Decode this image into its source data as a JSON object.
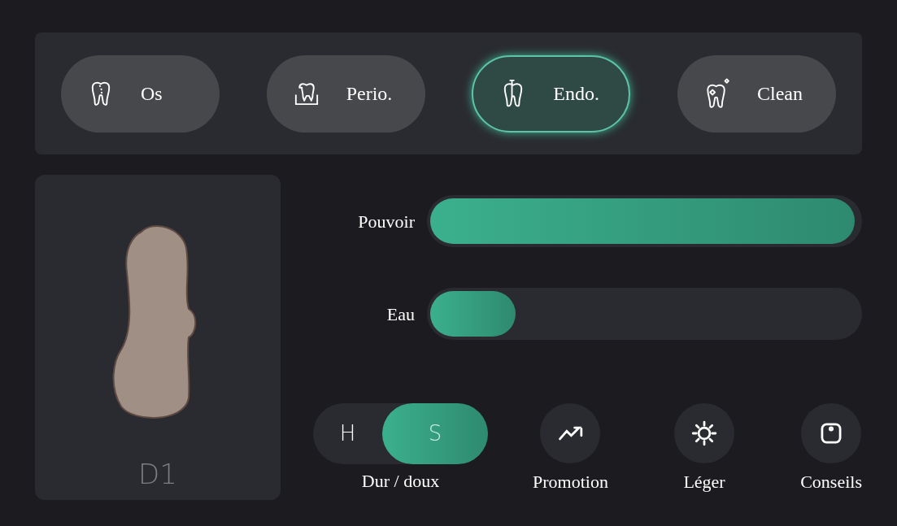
{
  "modes": [
    {
      "label": "Os",
      "kind": "bone",
      "selected": false
    },
    {
      "label": "Perio.",
      "kind": "gum",
      "selected": false
    },
    {
      "label": "Endo.",
      "kind": "root",
      "selected": true
    },
    {
      "label": "Clean",
      "kind": "sparkle",
      "selected": false
    }
  ],
  "bone_type": {
    "label": "D1"
  },
  "sliders": [
    {
      "label": "Pouvoir",
      "level": 0.99
    },
    {
      "label": "Eau",
      "level": 0.2
    }
  ],
  "hardness": {
    "caption": "Dur / doux",
    "options": [
      {
        "label": "H",
        "selected": false
      },
      {
        "label": "S",
        "selected": true
      }
    ]
  },
  "actions": [
    {
      "label": "Promotion",
      "kind": "trend"
    },
    {
      "label": "Léger",
      "kind": "light"
    },
    {
      "label": "Conseils",
      "kind": "tips"
    }
  ]
}
